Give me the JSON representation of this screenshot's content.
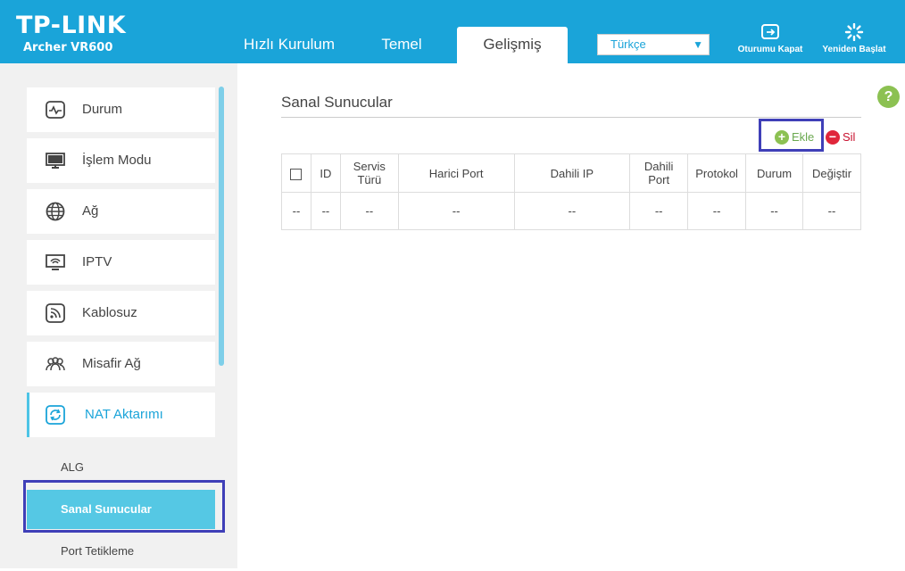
{
  "header": {
    "brand": "TP-LINK",
    "model": "Archer VR600",
    "tabs": [
      {
        "label": "Hızlı Kurulum"
      },
      {
        "label": "Temel"
      },
      {
        "label": "Gelişmiş"
      }
    ],
    "language": "Türkçe",
    "logout_label": "Oturumu Kapat",
    "reboot_label": "Yeniden Başlat",
    "accent_color": "#1aa4d9"
  },
  "sidebar": {
    "items": [
      {
        "label": "Durum",
        "icon": "status-icon"
      },
      {
        "label": "İşlem Modu",
        "icon": "monitor-icon"
      },
      {
        "label": "Ağ",
        "icon": "globe-icon"
      },
      {
        "label": "IPTV",
        "icon": "iptv-icon"
      },
      {
        "label": "Kablosuz",
        "icon": "wireless-icon"
      },
      {
        "label": "Misafir Ağ",
        "icon": "guest-icon"
      },
      {
        "label": "NAT Aktarımı",
        "icon": "nat-icon"
      }
    ],
    "subitems": [
      {
        "label": "ALG"
      },
      {
        "label": "Sanal Sunucular"
      },
      {
        "label": "Port Tetikleme"
      }
    ]
  },
  "main": {
    "title": "Sanal Sunucular",
    "help": "?",
    "add_label": "Ekle",
    "delete_label": "Sil",
    "table": {
      "headers": [
        "ID",
        "Servis Türü",
        "Harici Port",
        "Dahili IP",
        "Dahili Port",
        "Protokol",
        "Durum",
        "Değiştir"
      ],
      "rows": [
        [
          "--",
          "--",
          "--",
          "--",
          "--",
          "--",
          "--",
          "--",
          "--"
        ]
      ]
    }
  }
}
